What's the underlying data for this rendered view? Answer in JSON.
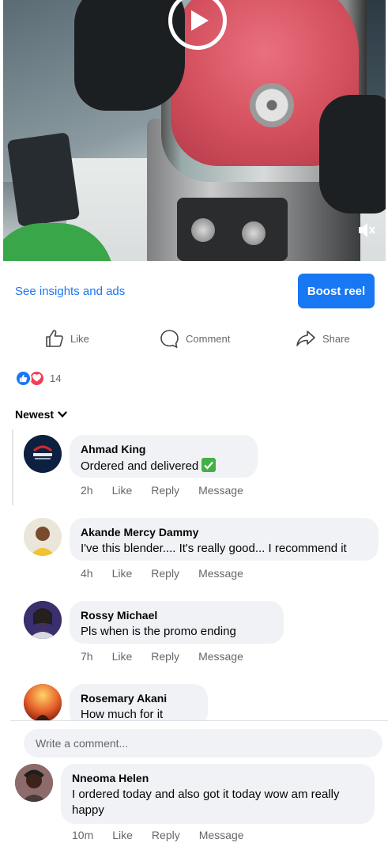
{
  "video": {
    "play_icon": "play-icon",
    "mute_icon": "volume-muted-icon"
  },
  "actions": {
    "insights_label": "See insights and ads",
    "boost_label": "Boost reel",
    "like_label": "Like",
    "comment_label": "Comment",
    "share_label": "Share"
  },
  "reactions": {
    "count": "14",
    "types": [
      "like",
      "love"
    ],
    "colors": {
      "like": "#1877f2",
      "love": "#f33e58"
    }
  },
  "sort": {
    "label": "Newest"
  },
  "comments": [
    {
      "name": "Ahmad King",
      "text": "Ordered and delivered",
      "time": "2h",
      "like": "Like",
      "reply": "Reply",
      "message": "Message"
    },
    {
      "name": "Akande Mercy Dammy",
      "text": "I've this blender.... It's really good... I recommend it",
      "time": "4h",
      "like": "Like",
      "reply": "Reply",
      "message": "Message"
    },
    {
      "name": "Rossy Michael",
      "text": "Pls when is the promo ending",
      "time": "7h",
      "like": "Like",
      "reply": "Reply",
      "message": "Message"
    },
    {
      "name": "Rosemary Akani",
      "text": "How much for it"
    },
    {
      "name": "Nneoma Helen",
      "text_line1": "I ordered today and also got it today wow am really",
      "text_line2": "happy",
      "time": "10m",
      "like": "Like",
      "reply": "Reply",
      "message": "Message"
    }
  ],
  "composer": {
    "placeholder": "Write a comment..."
  },
  "colors": {
    "accent": "#1877f2",
    "bubble": "#f0f2f5",
    "muted_text": "#65676b"
  }
}
